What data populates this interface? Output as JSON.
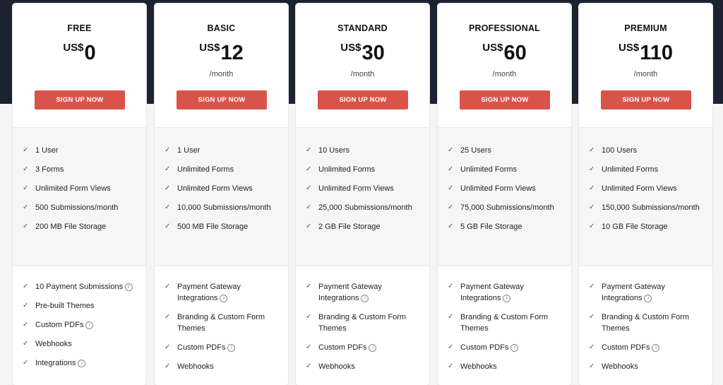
{
  "plans": [
    {
      "name": "FREE",
      "currency": "US$",
      "amount": "0",
      "period": "",
      "cta": "SIGN UP NOW",
      "core": [
        "1 User",
        "3 Forms",
        "Unlimited Form Views",
        "500 Submissions/month",
        "200 MB File Storage"
      ],
      "extra": [
        {
          "text": "10 Payment Submissions",
          "info": true
        },
        {
          "text": "Pre-built Themes",
          "info": false
        },
        {
          "text": "Custom PDFs",
          "info": true
        },
        {
          "text": "Webhooks",
          "info": false
        },
        {
          "text": "Integrations",
          "info": true
        }
      ]
    },
    {
      "name": "BASIC",
      "currency": "US$",
      "amount": "12",
      "period": "/month",
      "cta": "SIGN UP NOW",
      "core": [
        "1 User",
        "Unlimited Forms",
        "Unlimited Form Views",
        "10,000 Submissions/month",
        "500 MB File Storage"
      ],
      "extra": [
        {
          "text": "Payment Gateway Integrations",
          "info": true
        },
        {
          "text": "Branding & Custom Form Themes",
          "info": false
        },
        {
          "text": "Custom PDFs",
          "info": true
        },
        {
          "text": "Webhooks",
          "info": false
        }
      ]
    },
    {
      "name": "STANDARD",
      "currency": "US$",
      "amount": "30",
      "period": "/month",
      "cta": "SIGN UP NOW",
      "core": [
        "10 Users",
        "Unlimited Forms",
        "Unlimited Form Views",
        "25,000 Submissions/month",
        "2 GB File Storage"
      ],
      "extra": [
        {
          "text": "Payment Gateway Integrations",
          "info": true
        },
        {
          "text": "Branding & Custom Form Themes",
          "info": false
        },
        {
          "text": "Custom PDFs",
          "info": true
        },
        {
          "text": "Webhooks",
          "info": false
        }
      ]
    },
    {
      "name": "PROFESSIONAL",
      "currency": "US$",
      "amount": "60",
      "period": "/month",
      "cta": "SIGN UP NOW",
      "core": [
        "25 Users",
        "Unlimited Forms",
        "Unlimited Form Views",
        "75,000 Submissions/month",
        "5 GB File Storage"
      ],
      "extra": [
        {
          "text": "Payment Gateway Integrations",
          "info": true
        },
        {
          "text": "Branding & Custom Form Themes",
          "info": false
        },
        {
          "text": "Custom PDFs",
          "info": true
        },
        {
          "text": "Webhooks",
          "info": false
        }
      ]
    },
    {
      "name": "PREMIUM",
      "currency": "US$",
      "amount": "110",
      "period": "/month",
      "cta": "SIGN UP NOW",
      "core": [
        "100 Users",
        "Unlimited Forms",
        "Unlimited Form Views",
        "150,000 Submissions/month",
        "10 GB File Storage"
      ],
      "extra": [
        {
          "text": "Payment Gateway Integrations",
          "info": true
        },
        {
          "text": "Branding & Custom Form Themes",
          "info": false
        },
        {
          "text": "Custom PDFs",
          "info": true
        },
        {
          "text": "Webhooks",
          "info": false
        }
      ]
    }
  ],
  "icons": {
    "check": "check-icon",
    "info": "info-icon"
  },
  "colors": {
    "header_bg": "#1d2230",
    "cta": "#d9534a",
    "page_bg": "#f5f5f6"
  }
}
